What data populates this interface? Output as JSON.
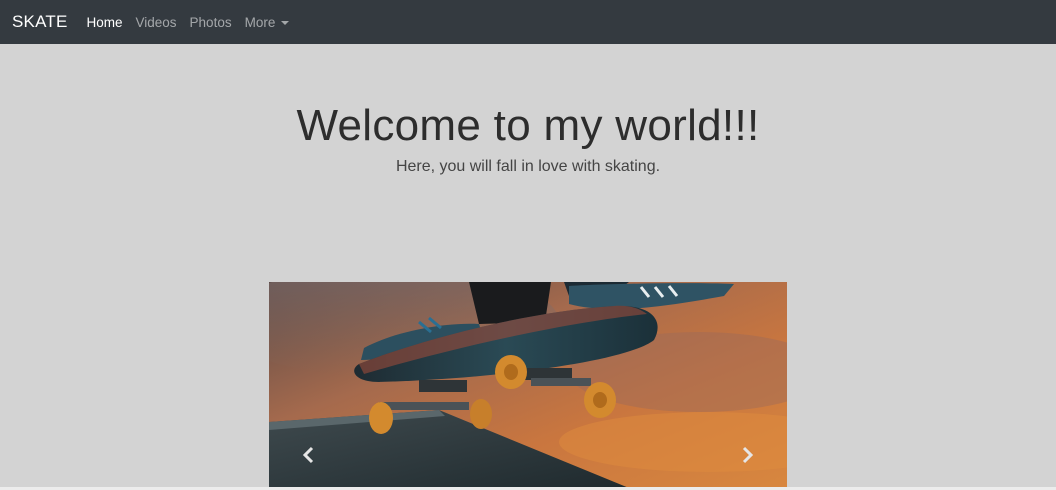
{
  "navbar": {
    "brand": "SKATE",
    "links": [
      {
        "label": "Home",
        "active": true
      },
      {
        "label": "Videos",
        "active": false
      },
      {
        "label": "Photos",
        "active": false
      },
      {
        "label": "More",
        "active": false,
        "dropdown": true
      }
    ],
    "background": "#343a40"
  },
  "hero": {
    "title": "Welcome to my world!!!",
    "subtitle": "Here, you will fall in love with skating."
  },
  "carousel": {
    "image": "skateboard-photo",
    "prev_icon": "chevron-left-icon",
    "next_icon": "chevron-right-icon"
  },
  "colors": {
    "page_background": "#d3d3d3",
    "nav_text_muted": "rgba(255,255,255,0.55)"
  }
}
